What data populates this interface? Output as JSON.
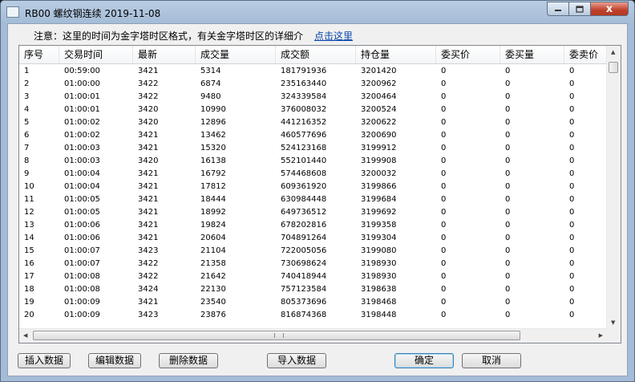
{
  "window": {
    "title": "RB00 螺纹钢连续 2019-11-08",
    "controls": {
      "close": "x"
    }
  },
  "notice": {
    "text": "注意：这里的时间为金字塔时区格式，有关金字塔时区的详细介",
    "link": "点击这里"
  },
  "table": {
    "columns": [
      "序号",
      "交易时间",
      "最新",
      "成交量",
      "成交额",
      "持仓量",
      "委买价",
      "委买量",
      "委卖价"
    ],
    "rows": [
      [
        "1",
        "00:59:00",
        "3421",
        "5314",
        "181791936",
        "3201420",
        "0",
        "0",
        "0"
      ],
      [
        "2",
        "01:00:00",
        "3422",
        "6874",
        "235163440",
        "3200962",
        "0",
        "0",
        "0"
      ],
      [
        "3",
        "01:00:01",
        "3422",
        "9480",
        "324339584",
        "3200464",
        "0",
        "0",
        "0"
      ],
      [
        "4",
        "01:00:01",
        "3420",
        "10990",
        "376008032",
        "3200524",
        "0",
        "0",
        "0"
      ],
      [
        "5",
        "01:00:02",
        "3420",
        "12896",
        "441216352",
        "3200622",
        "0",
        "0",
        "0"
      ],
      [
        "6",
        "01:00:02",
        "3421",
        "13462",
        "460577696",
        "3200690",
        "0",
        "0",
        "0"
      ],
      [
        "7",
        "01:00:03",
        "3421",
        "15320",
        "524123168",
        "3199912",
        "0",
        "0",
        "0"
      ],
      [
        "8",
        "01:00:03",
        "3420",
        "16138",
        "552101440",
        "3199908",
        "0",
        "0",
        "0"
      ],
      [
        "9",
        "01:00:04",
        "3421",
        "16792",
        "574468608",
        "3200032",
        "0",
        "0",
        "0"
      ],
      [
        "10",
        "01:00:04",
        "3421",
        "17812",
        "609361920",
        "3199866",
        "0",
        "0",
        "0"
      ],
      [
        "11",
        "01:00:05",
        "3421",
        "18444",
        "630984448",
        "3199684",
        "0",
        "0",
        "0"
      ],
      [
        "12",
        "01:00:05",
        "3421",
        "18992",
        "649736512",
        "3199692",
        "0",
        "0",
        "0"
      ],
      [
        "13",
        "01:00:06",
        "3421",
        "19824",
        "678202816",
        "3199358",
        "0",
        "0",
        "0"
      ],
      [
        "14",
        "01:00:06",
        "3421",
        "20604",
        "704891264",
        "3199304",
        "0",
        "0",
        "0"
      ],
      [
        "15",
        "01:00:07",
        "3423",
        "21104",
        "722005056",
        "3199080",
        "0",
        "0",
        "0"
      ],
      [
        "16",
        "01:00:07",
        "3422",
        "21358",
        "730698624",
        "3198930",
        "0",
        "0",
        "0"
      ],
      [
        "17",
        "01:00:08",
        "3422",
        "21642",
        "740418944",
        "3198930",
        "0",
        "0",
        "0"
      ],
      [
        "18",
        "01:00:08",
        "3424",
        "22130",
        "757123584",
        "3198638",
        "0",
        "0",
        "0"
      ],
      [
        "19",
        "01:00:09",
        "3421",
        "23540",
        "805373696",
        "3198468",
        "0",
        "0",
        "0"
      ],
      [
        "20",
        "01:00:09",
        "3423",
        "23876",
        "816874368",
        "3198448",
        "0",
        "0",
        "0"
      ]
    ]
  },
  "buttons": {
    "insert": "插入数据",
    "edit": "编辑数据",
    "delete": "删除数据",
    "import": "导入数据",
    "ok": "确定",
    "cancel": "取消"
  },
  "colors": {
    "titlebar": "#a4bcd7",
    "link": "#0645ad",
    "close_button": "#c0402a"
  },
  "icons": [
    "app-icon",
    "minimize-icon",
    "maximize-icon",
    "close-icon",
    "scroll-up-arrow-icon",
    "scroll-down-arrow-icon",
    "scroll-left-arrow-icon",
    "scroll-right-arrow-icon"
  ]
}
